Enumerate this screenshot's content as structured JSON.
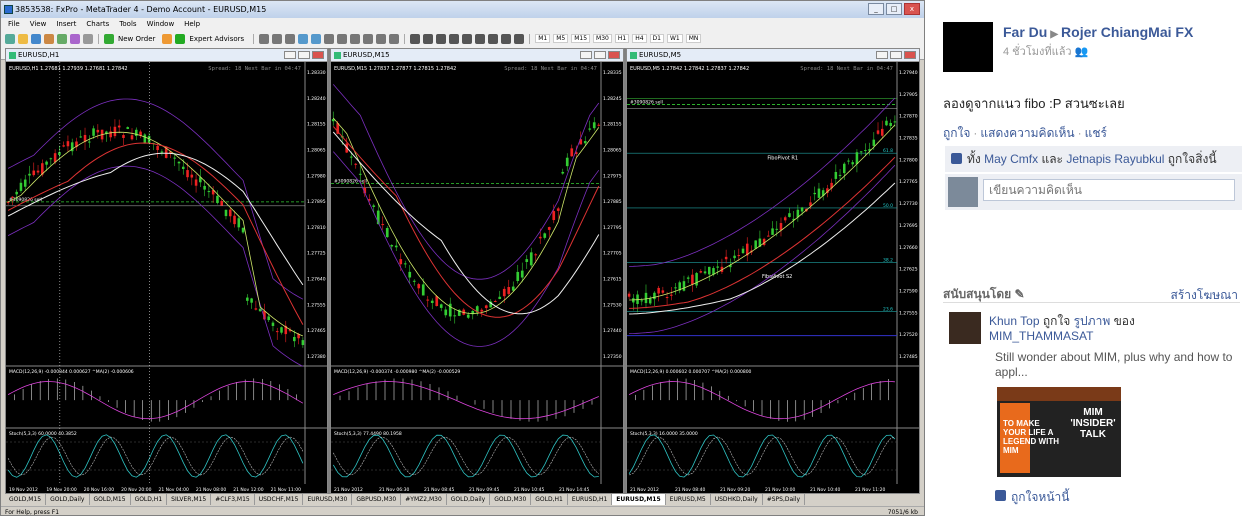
{
  "mt4": {
    "title": "3853538: FxPro - MetaTrader 4 - Demo Account - EURUSD,M15",
    "menu": [
      "File",
      "View",
      "Insert",
      "Charts",
      "Tools",
      "Window",
      "Help"
    ],
    "toolbar": {
      "new_order": "New Order",
      "expert_advisors": "Expert Advisors",
      "timeframes": [
        "M1",
        "M5",
        "M15",
        "M30",
        "H1",
        "H4",
        "D1",
        "W1",
        "MN"
      ]
    },
    "charts": [
      {
        "window_title": "EURUSD,H1",
        "info": "EURUSD,H1 1.27681 1.27939 1.27681 1.27842",
        "spread": "Spread: 18  Next Bar in 04:47",
        "pending": "#3090826 sell",
        "macd_label": "MACD(12,26,9) -0.000844 0.000627  ^MA(2) -0.000606",
        "stoch_label": "Stoch(5,3,3) 60.0000 40.3852",
        "price_scale": [
          "1.28330",
          "1.28240",
          "1.28155",
          "1.28065",
          "1.27980",
          "1.27895",
          "1.27810",
          "1.27725",
          "1.27640",
          "1.27555",
          "1.27465",
          "1.27380"
        ],
        "time_scale": [
          "19 Nov 2012",
          "19 Nov 20:00",
          "20 Nov 16:00",
          "20 Nov 20:00",
          "21 Nov 04:00",
          "21 Nov 08:00",
          "21 Nov 12:00",
          "21 Nov 11:00"
        ]
      },
      {
        "window_title": "EURUSD,M15",
        "info": "EURUSD,M15 1.27837 1.27877 1.27815 1.27842",
        "spread": "Spread: 18  Next Bar in 04:47",
        "pending": "#3090826 sell",
        "macd_label": "MACD(12,26,9) -0.000374 -0.000980  ^MA(2) -0.000529",
        "stoch_label": "Stoch(5,3,3) 77.4490 80.1958",
        "price_scale": [
          "1.28335",
          "1.28245",
          "1.28155",
          "1.28065",
          "1.27975",
          "1.27885",
          "1.27795",
          "1.27705",
          "1.27615",
          "1.27530",
          "1.27440",
          "1.27350"
        ],
        "time_scale": [
          "21 Nov 2012",
          "21 Nov 06:30",
          "21 Nov 08:45",
          "21 Nov 09:45",
          "21 Nov 10:45",
          "21 Nov 14:45"
        ]
      },
      {
        "window_title": "EURUSD,M5",
        "info": "EURUSD,M5 1.27842 1.27842 1.27837 1.27842",
        "spread": "Spread: 18  Next Bar in 04:47",
        "pending": "#3090826 sell",
        "pivots": [
          "FiboPivot R1",
          "FiboPivot S2"
        ],
        "fibo_levels": [
          "61.8",
          "50.0",
          "38.2",
          "23.6"
        ],
        "macd_label": "MACD(12,26,9) 0.000602 0.000707  ^MA(2) 0.000800",
        "stoch_label": "Stoch(5,3,3) 16.0000 35.0000",
        "price_scale": [
          "1.27940",
          "1.27905",
          "1.27870",
          "1.27835",
          "1.27800",
          "1.27765",
          "1.27730",
          "1.27695",
          "1.27660",
          "1.27625",
          "1.27590",
          "1.27555",
          "1.27520",
          "1.27485"
        ],
        "time_scale": [
          "21 Nov 2012",
          "21 Nov 08:40",
          "21 Nov 09:20",
          "21 Nov 10:00",
          "21 Nov 10:40",
          "21 Nov 11:20"
        ]
      }
    ],
    "tabs": [
      "GOLD,M15",
      "GOLD,Daily",
      "GOLD,M15",
      "GOLD,H1",
      "SILVER,M15",
      "#CLF3,M15",
      "USDCHF,M15",
      "EURUSD,M30",
      "GBPUSD,M30",
      "#YMZ2,M30",
      "GOLD,Daily",
      "GOLD,M30",
      "GOLD,H1",
      "EURUSD,H1",
      "EURUSD,M15",
      "EURUSD,M5",
      "USDHKD,Daily",
      "#SPS,Daily"
    ],
    "active_tab_index": 14,
    "status_left": "For Help, press F1",
    "status_right": "7051/6 kb"
  },
  "facebook": {
    "author": "Far Du",
    "target": "Rojer ChiangMai FX",
    "time": "4 ชั่วโมงที่แล้ว",
    "post_text": "ลองดูจากแนว fibo :P สวนซะเลย",
    "actions": [
      "ถูกใจ",
      "แสดงความคิดเห็น",
      "แชร์"
    ],
    "likes": {
      "prefix": "ทั้ง",
      "name1": "May Cmfx",
      "and": "และ",
      "name2": "Jetnapis Rayubkul",
      "suffix": "ถูกใจสิ่งนี้"
    },
    "comment_placeholder": "เขียนความคิดเห็น",
    "sponsored_label": "สนับสนุนโดย",
    "create_ad": "สร้างโฆษณา",
    "ad": {
      "user": "Khun Top",
      "liked_text": "ถูกใจ",
      "photo_link": "รูปภาพ",
      "of": "ของ",
      "page": "MIM_THAMMASAT",
      "text": "Still wonder about MIM, plus why and how to appl...",
      "image_left": "TO MAKE YOUR LIFE A LEGEND WITH MIM",
      "image_right": "MIM 'INSIDER' TALK",
      "like_page": "ถูกใจหน้านี้"
    }
  }
}
